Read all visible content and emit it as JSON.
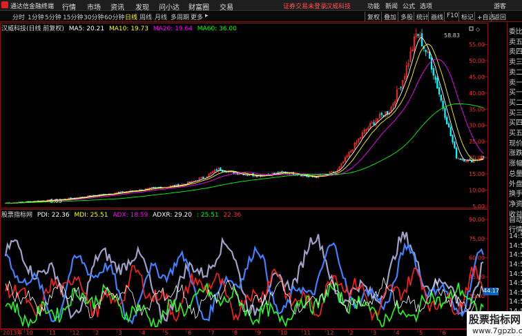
{
  "menubar": {
    "app_title": "通达信金融终端",
    "items": [
      "行情",
      "市场",
      "资讯",
      "发现",
      "问小达",
      "财富圈",
      "交易"
    ],
    "warning": "证券交易未登录",
    "stock": "汉威科技",
    "right_items": [
      "功能",
      "新闻",
      "公式",
      "选项"
    ],
    "guest": "游客"
  },
  "toolbar": {
    "periods": [
      "分时",
      "1分钟",
      "5分钟",
      "15分钟",
      "30分钟",
      "60分钟",
      "日线",
      "周线",
      "月线",
      "多周期",
      "更多"
    ],
    "active_period": "日线",
    "more_arrow": "▸",
    "right_buttons": [
      "复权",
      "叠加",
      "多股",
      "统计",
      "画线",
      "F10",
      "标记",
      "+自选",
      "返回"
    ]
  },
  "price_panel": {
    "title": "汉威科技(日线 前复权)",
    "ma": [
      {
        "label": "MA5: 20.21",
        "color": "#ffffff"
      },
      {
        "label": "MA10: 19.73",
        "color": "#ffff00"
      },
      {
        "label": "MA20: 19.64",
        "color": "#ff00ff"
      },
      {
        "label": "MA60: 36.00",
        "color": "#00ff00"
      }
    ],
    "high_label": "58.83",
    "low_label": "6.05",
    "y_ticks": [
      {
        "v": 55,
        "t": "55.00"
      },
      {
        "v": 50,
        "t": "50.00"
      },
      {
        "v": 45,
        "t": "45.00"
      },
      {
        "v": 40,
        "t": "40.00"
      },
      {
        "v": 35,
        "t": "35.00"
      },
      {
        "v": 30,
        "t": "30.00"
      },
      {
        "v": 25,
        "t": "25.00"
      },
      {
        "v": 20,
        "t": "20.00"
      },
      {
        "v": 15,
        "t": "15.00"
      },
      {
        "v": 10,
        "t": "10.00"
      },
      {
        "v": 5,
        "t": "5.00"
      }
    ]
  },
  "indicator_panel": {
    "title": "股票指标网",
    "labels": [
      {
        "text": "PDI: 22.36",
        "color": "#ffffff"
      },
      {
        "text": "MDI: 25.51",
        "color": "#ffff00"
      },
      {
        "text": "ADX: 18.59",
        "color": "#ff00ff"
      },
      {
        "text": "ADXR: 29.20",
        "color": "#ffffff"
      },
      {
        "text": ": 25.51",
        "color": "#00ff00"
      },
      {
        "text": "22.36",
        "color": "#ff3030"
      }
    ],
    "y_ticks": [
      {
        "v": 90,
        "t": "90.00"
      },
      {
        "v": 75,
        "t": "75.00"
      },
      {
        "v": 60,
        "t": "60.00"
      },
      {
        "v": 45,
        "t": "45.00"
      },
      {
        "v": 30,
        "t": "30.00"
      },
      {
        "v": 15,
        "t": "15.00"
      }
    ],
    "current_value": "44.17"
  },
  "x_axis": [
    "2013年",
    "10",
    "11",
    "12",
    "2",
    "3",
    "4",
    "5",
    "6",
    "7",
    "8",
    "9",
    "10",
    "11",
    "12",
    "2",
    "3",
    "4",
    "5",
    "6"
  ],
  "right_panel": {
    "top_items": [
      "委比",
      "卖五",
      "卖四",
      "卖三",
      "卖二",
      "卖一",
      "买一",
      "买二",
      "买三",
      "买四",
      "买五",
      "现价",
      "涨跌",
      "涨幅",
      "总量",
      "外盘",
      "换手",
      "净资",
      "收益"
    ],
    "bottom_items": [
      "自动",
      "行情",
      "14:5",
      "14:5",
      "14:5",
      "14:5",
      "14:5",
      "14:5",
      "14:5",
      "14:5",
      "14:5",
      "14:5",
      "14:5"
    ]
  },
  "watermark": {
    "line1": "股票指标网",
    "line2": "www.7gpzb.com"
  },
  "colors": {
    "up": "#ff3030",
    "down": "#00ffff",
    "grid": "#8a1010",
    "axis_text": "#ff3030"
  },
  "chart_data": {
    "type": "line",
    "price_ylim": [
      5,
      60
    ],
    "indicator_ylim": [
      5,
      95
    ],
    "close_approx": [
      6.0,
      6.2,
      6.5,
      6.8,
      7.0,
      7.5,
      8.0,
      8.5,
      9.0,
      9.5,
      10.0,
      10.5,
      11.0,
      11.5,
      12.5,
      14.0,
      16.5,
      15.5,
      15.0,
      14.5,
      15.0,
      15.5,
      15.0,
      14.0,
      14.5,
      16.0,
      22.0,
      28.0,
      32.0,
      35.0,
      45.0,
      58.83,
      50.0,
      35.0,
      20.0,
      19.0,
      20.2
    ]
  }
}
